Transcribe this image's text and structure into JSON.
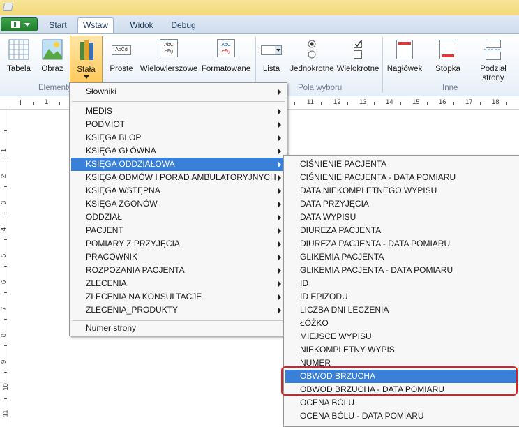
{
  "colors": {
    "accent": "#3a7fd8",
    "annotation": "#e01e1e",
    "file_button": "#2c8a38"
  },
  "tabs": [
    "Start",
    "Wstaw",
    "Widok",
    "Debug"
  ],
  "ribbon": {
    "buttons": {
      "tabela": "Tabela",
      "obraz": "Obraz",
      "stala": "Stała",
      "proste": "Proste",
      "wielowierszowe": "Wielowierszowe",
      "formatowane": "Formatowane",
      "lista": "Lista",
      "jednokrotne": "Jednokrotne",
      "wielokrotne": "Wielokrotne",
      "naglowek": "Nagłówek",
      "stopka": "Stopka",
      "podzial_1": "Podział",
      "podzial_2": "strony"
    },
    "icon_text": {
      "proste": "AbCd",
      "wiel_1": "AbC",
      "wiel_2": "eFg",
      "form_1": "AbC",
      "form_2": "eFg"
    },
    "groups": {
      "elementy": "Elementy",
      "pola_wyboru": "Pola wyboru",
      "inne": "Inne"
    }
  },
  "ruler": {
    "numbers": [
      "1",
      "11",
      "12",
      "13",
      "14",
      "15",
      "16",
      "17",
      "18"
    ]
  },
  "vruler": {
    "numbers": [
      "1",
      "2",
      "3",
      "4",
      "5",
      "6",
      "7",
      "8",
      "9",
      "10",
      "11"
    ]
  },
  "menu1": {
    "slowniki": "Słowniki",
    "items": [
      "MEDIS",
      "PODMIOT",
      "KSIĘGA BLOP",
      "KSIĘGA GŁÓWNA",
      "KSIĘGA ODDZIAŁOWA",
      "KSIĘGA ODMÓW I PORAD AMBULATORYJNYCH",
      "KSIĘGA WSTĘPNA",
      "KSIĘGA ZGONÓW",
      "ODDZIAŁ",
      "PACJENT",
      "POMIARY Z PRZYJĘCIA",
      "PRACOWNIK",
      "ROZPOZANIA PACJENTA",
      "ZLECENIA",
      "ZLECENIA NA KONSULTACJE",
      "ZLECENIA_PRODUKTY"
    ],
    "numer_strony": "Numer strony"
  },
  "menu2": {
    "items": [
      "CIŚNIENIE PACJENTA",
      "CIŚNIENIE PACJENTA - DATA POMIARU",
      "DATA NIEKOMPLETNEGO WYPISU",
      "DATA PRZYJĘCIA",
      "DATA WYPISU",
      "DIUREZA PACJENTA",
      "DIUREZA PACJENTA - DATA POMIARU",
      "GLIKEMIA PACJENTA",
      "GLIKEMIA PACJENTA - DATA POMIARU",
      "ID",
      "ID EPIZODU",
      "LICZBA DNI LECZENIA",
      "ŁÓŻKO",
      "MIEJSCE WYPISU",
      "NIEKOMPLETNY WYPIS",
      "NUMER",
      "OBWOD BRZUCHA",
      "OBWOD BRZUCHA - DATA POMIARU",
      "OCENA BÓLU",
      "OCENA BÓLU - DATA POMIARU"
    ]
  }
}
